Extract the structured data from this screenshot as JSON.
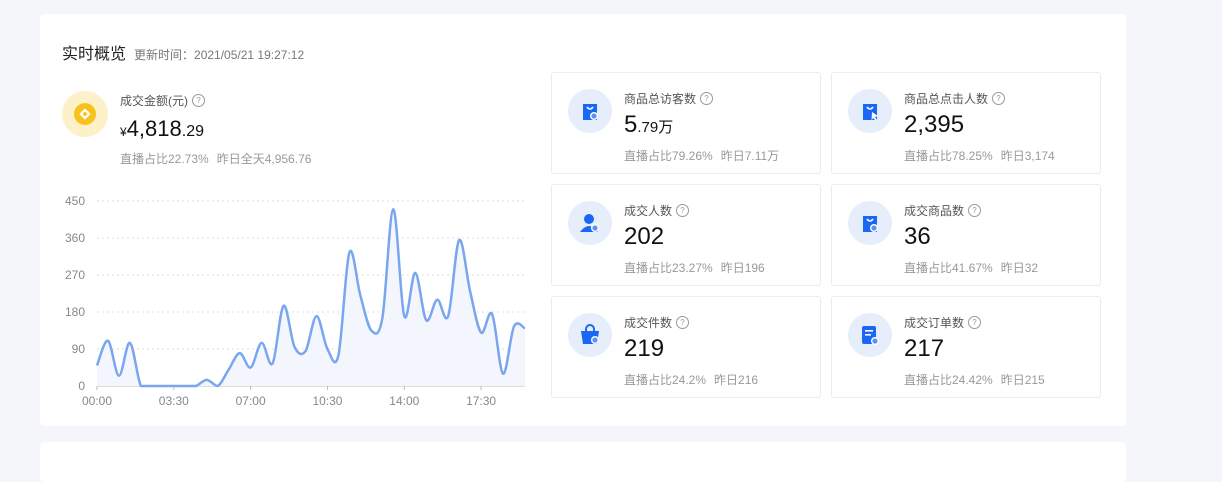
{
  "header": {
    "title": "实时概览",
    "update_time": "更新时间：2021/05/21 19:27:12"
  },
  "gmv": {
    "label": "成交金额(元)",
    "currency": "¥",
    "value_int": "4,818",
    "value_dec": ".29",
    "live_share": "直播占比22.73%",
    "yesterday": "昨日全天4,956.76",
    "icon": "coin-icon",
    "icon_color": "#f8c21c"
  },
  "metrics": [
    {
      "label": "商品总访客数",
      "value_main": "5",
      "value_small": ".79万",
      "live_share": "直播占比79.26%",
      "yesterday": "昨日7.11万",
      "icon": "bag-visitor-icon"
    },
    {
      "label": "商品总点击人数",
      "value_main": "2,395",
      "value_small": "",
      "live_share": "直播占比78.25%",
      "yesterday": "昨日3,174",
      "icon": "bag-click-icon"
    },
    {
      "label": "成交人数",
      "value_main": "202",
      "value_small": "",
      "live_share": "直播占比23.27%",
      "yesterday": "昨日196",
      "icon": "user-yuan-icon"
    },
    {
      "label": "成交商品数",
      "value_main": "36",
      "value_small": "",
      "live_share": "直播占比41.67%",
      "yesterday": "昨日32",
      "icon": "bag-yuan-icon"
    },
    {
      "label": "成交件数",
      "value_main": "219",
      "value_small": "",
      "live_share": "直播占比24.2%",
      "yesterday": "昨日216",
      "icon": "basket-yuan-icon"
    },
    {
      "label": "成交订单数",
      "value_main": "217",
      "value_small": "",
      "live_share": "直播占比24.42%",
      "yesterday": "昨日215",
      "icon": "order-yuan-icon"
    }
  ],
  "colors": {
    "accent": "#1a66f5",
    "line": "#7aa6f0",
    "icon_bg": "#e6eefc"
  },
  "chart_data": {
    "type": "line",
    "x_tick_labels": [
      "00:00",
      "03:30",
      "07:00",
      "10:30",
      "14:00",
      "17:30"
    ],
    "x_ticks_hours": [
      0,
      3.5,
      7,
      10.5,
      14,
      17.5
    ],
    "xlim": [
      0,
      19.5
    ],
    "y_ticks": [
      0,
      90,
      180,
      270,
      360,
      450
    ],
    "ylim": [
      0,
      450
    ],
    "grid": true,
    "x": [
      0,
      0.5,
      1,
      1.5,
      2,
      2.5,
      3,
      3.5,
      4,
      4.5,
      5,
      5.5,
      6,
      6.5,
      7,
      7.5,
      8,
      8.5,
      9,
      9.5,
      10,
      10.5,
      11,
      11.5,
      12,
      12.5,
      13,
      13.5,
      14,
      14.5,
      15,
      15.5,
      16,
      16.5,
      17,
      17.5,
      18,
      18.5,
      19,
      19.5
    ],
    "values": [
      50,
      110,
      25,
      105,
      0,
      0,
      0,
      0,
      0,
      0,
      15,
      0,
      40,
      80,
      45,
      105,
      55,
      195,
      95,
      85,
      170,
      90,
      75,
      325,
      220,
      135,
      165,
      430,
      170,
      275,
      160,
      210,
      170,
      355,
      230,
      130,
      175,
      30,
      145,
      140
    ]
  }
}
